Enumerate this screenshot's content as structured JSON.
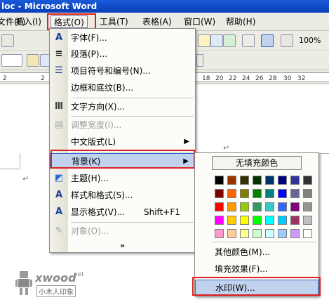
{
  "window": {
    "title": "loc - Microsoft Word"
  },
  "menubar": {
    "items": [
      {
        "label": "文件(F)"
      },
      {
        "label": "插入(I)"
      },
      {
        "label": "格式(O)"
      },
      {
        "label": "工具(T)"
      },
      {
        "label": "表格(A)"
      },
      {
        "label": "窗口(W)"
      },
      {
        "label": "帮助(H)"
      }
    ]
  },
  "toolbar": {
    "zoom": "100%"
  },
  "ruler": {
    "ticks": [
      "2",
      "2",
      "18",
      "20",
      "22",
      "24",
      "26",
      "28",
      "30",
      "32"
    ]
  },
  "document": {
    "para_mark": "↵"
  },
  "format_menu": {
    "items": [
      {
        "label": "字体(F)...",
        "icon": "font-icon",
        "glyph": "A",
        "disabled": false
      },
      {
        "label": "段落(P)...",
        "icon": "paragraph-icon",
        "glyph": "≡",
        "disabled": false
      },
      {
        "label": "项目符号和编号(N)...",
        "icon": "bullets-icon",
        "glyph": "☰",
        "disabled": false
      },
      {
        "label": "边框和底纹(B)...",
        "icon": "",
        "glyph": "",
        "disabled": false
      },
      {
        "label": "文字方向(X)...",
        "icon": "text-direction-icon",
        "glyph": "Ⅲ",
        "disabled": false
      },
      {
        "label": "调整宽度(I)...",
        "icon": "adjust-width-icon",
        "glyph": "▤",
        "disabled": true
      },
      {
        "label": "中文版式(L)",
        "icon": "",
        "glyph": "",
        "disabled": false,
        "submenu": true
      },
      {
        "label": "背景(K)",
        "icon": "",
        "glyph": "",
        "disabled": false,
        "submenu": true,
        "highlighted": true
      },
      {
        "label": "主题(H)...",
        "icon": "theme-icon",
        "glyph": "◩",
        "disabled": false
      },
      {
        "label": "样式和格式(S)...",
        "icon": "styles-icon",
        "glyph": "A",
        "disabled": false
      },
      {
        "label": "显示格式(V)...",
        "icon": "reveal-format-icon",
        "glyph": "A",
        "disabled": false,
        "shortcut": "Shift+F1"
      },
      {
        "label": "对象(O)...",
        "icon": "object-icon",
        "glyph": "✎",
        "disabled": true
      }
    ],
    "expand": "»"
  },
  "background_submenu": {
    "no_fill": "无填充颜色",
    "palette": [
      [
        "#000000",
        "#993300",
        "#333300",
        "#003300",
        "#003366",
        "#000080",
        "#333399",
        "#333333"
      ],
      [
        "#800000",
        "#ff6600",
        "#808000",
        "#008000",
        "#008080",
        "#0000ff",
        "#666699",
        "#808080"
      ],
      [
        "#ff0000",
        "#ff9900",
        "#99cc00",
        "#339966",
        "#33cccc",
        "#3366ff",
        "#800080",
        "#969696"
      ],
      [
        "#ff00ff",
        "#ffcc00",
        "#ffff00",
        "#00ff00",
        "#00ffff",
        "#00ccff",
        "#993366",
        "#c0c0c0"
      ],
      [
        "#ff99cc",
        "#ffcc99",
        "#ffff99",
        "#ccffcc",
        "#ccffff",
        "#99ccff",
        "#cc99ff",
        "#ffffff"
      ]
    ],
    "more_colors": "其他颜色(M)...",
    "fill_effects": "填充效果(F)...",
    "watermark": "水印(W)..."
  },
  "site_logo": {
    "brand": "xwood",
    "suffix": ".net",
    "tagline": "小木人印象"
  },
  "colors": {
    "highlight": "#c1d2ee",
    "annotation_red": "#e02020",
    "titlebar": "#0a3fb8"
  }
}
